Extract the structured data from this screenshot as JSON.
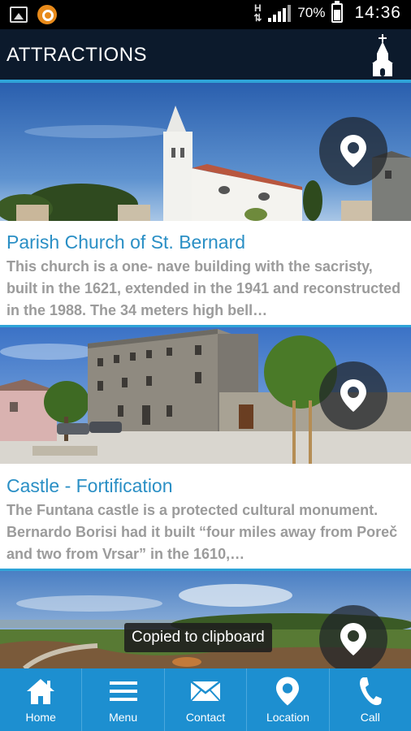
{
  "status_bar": {
    "network_type": "H",
    "battery": "70%",
    "time": "14:36",
    "icons": [
      "gallery-icon",
      "app-notification-icon",
      "signal-icon",
      "battery-icon"
    ]
  },
  "header": {
    "title": "ATTRACTIONS",
    "icon": "church-icon"
  },
  "attractions": [
    {
      "title": "Parish Church of St. Bernard",
      "description": "This church is a one- nave building with the sacristy, built in the 1621, extended in the 1941 and reconstructed in the 1988. The 34 meters high bell…",
      "image": "church-photo"
    },
    {
      "title": "Castle - Fortification",
      "description": "The Funtana castle is a protected cultural monument. Bernardo Borisi had it built “four miles away from Poreč and two from Vrsar” in the 1610,…",
      "image": "castle-photo"
    },
    {
      "title": "",
      "description": "",
      "image": "coast-photo"
    }
  ],
  "toast": "Copied to clipboard",
  "bottom_nav": [
    {
      "label": "Home",
      "icon": "home-icon"
    },
    {
      "label": "Menu",
      "icon": "menu-icon"
    },
    {
      "label": "Contact",
      "icon": "envelope-icon"
    },
    {
      "label": "Location",
      "icon": "map-pin-icon"
    },
    {
      "label": "Call",
      "icon": "phone-icon"
    }
  ],
  "colors": {
    "header_bg": "#0c1a2c",
    "accent": "#2fa4d8",
    "title_text": "#2a8fc5",
    "nav_bg": "#1d8fd0",
    "desc_text": "#9b9b9b"
  }
}
